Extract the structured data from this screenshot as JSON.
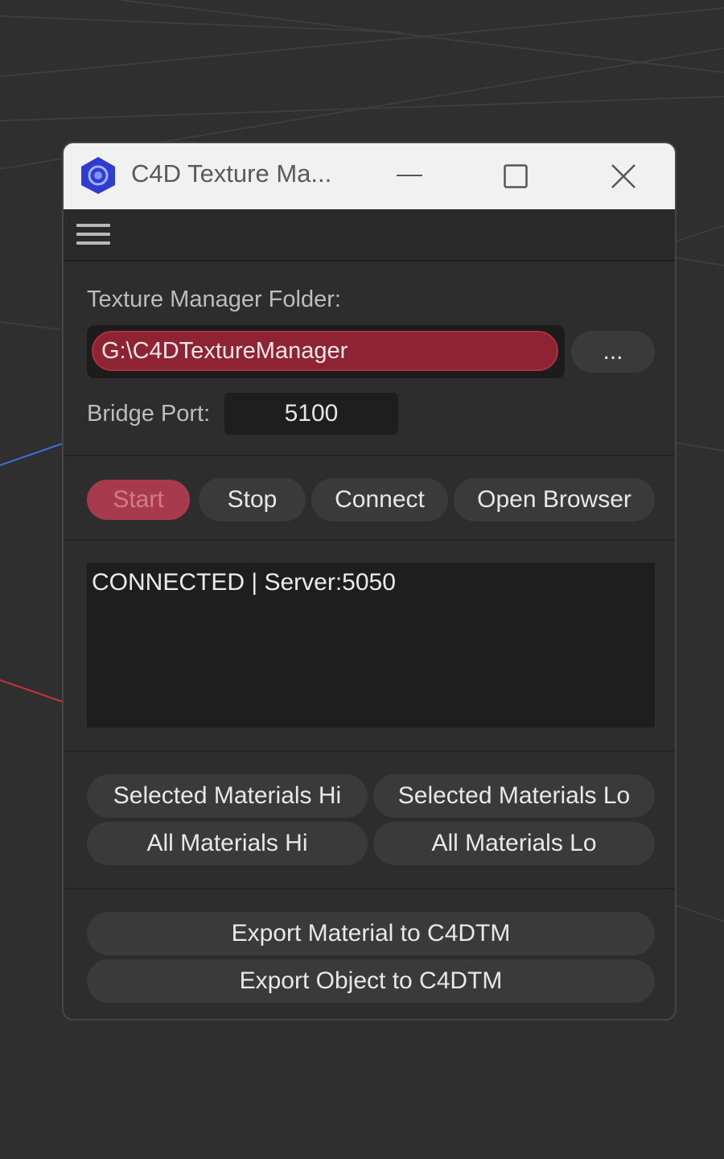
{
  "window": {
    "title": "C4D Texture Ma...",
    "controls": {
      "minimize_icon": "minimize-icon",
      "maximize_icon": "maximize-icon",
      "close_icon": "close-icon"
    }
  },
  "menu": {
    "icon": "hamburger-menu-icon"
  },
  "folder": {
    "label": "Texture Manager Folder:",
    "value": "G:\\C4DTextureManager",
    "browse_label": "..."
  },
  "port": {
    "label": "Bridge Port:",
    "value": "5100"
  },
  "server_buttons": {
    "start": "Start",
    "stop": "Stop",
    "connect": "Connect",
    "open_browser": "Open Browser"
  },
  "status": {
    "text": "CONNECTED | Server:5050"
  },
  "material_buttons": {
    "selected_hi": "Selected Materials Hi",
    "selected_lo": "Selected Materials Lo",
    "all_hi": "All Materials Hi",
    "all_lo": "All Materials Lo"
  },
  "export_buttons": {
    "export_material": "Export Material to C4DTM",
    "export_object": "Export Object to C4DTM"
  },
  "colors": {
    "accent_red": "#8e2433",
    "start_button": "#a83a4d",
    "app_icon_blue": "#2f3bd1",
    "background": "#2f2f2f",
    "panel": "#2d2d2d"
  }
}
